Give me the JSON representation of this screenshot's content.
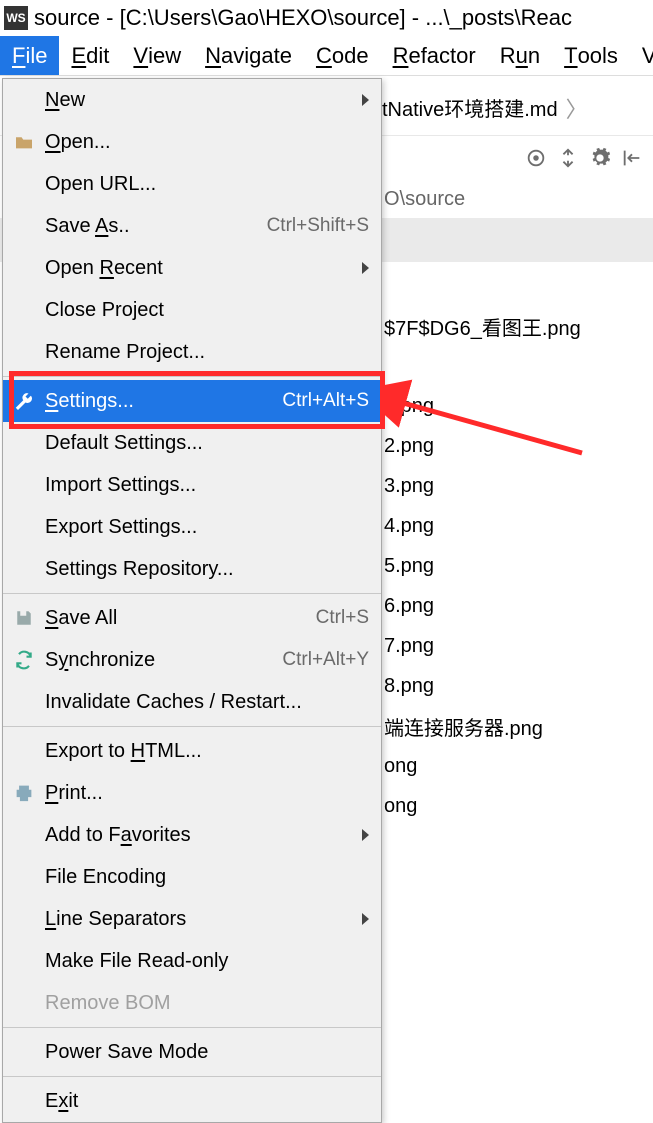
{
  "title": "source - [C:\\Users\\Gao\\HEXO\\source] - ...\\_posts\\Reac",
  "menu": [
    "File",
    "Edit",
    "View",
    "Navigate",
    "Code",
    "Refactor",
    "Run",
    "Tools",
    "V"
  ],
  "breadcrumb_tail": "tNative环境搭建.md",
  "path_tail": "O\\source",
  "file_menu": {
    "groups": [
      [
        {
          "label": "New",
          "shortcut": "",
          "submenu": true,
          "icon": ""
        },
        {
          "label": "Open...",
          "shortcut": "",
          "icon": "folder"
        },
        {
          "label": "Open URL...",
          "shortcut": "",
          "icon": ""
        },
        {
          "label": "Save As..",
          "shortcut": "Ctrl+Shift+S",
          "icon": ""
        },
        {
          "label": "Open Recent",
          "shortcut": "",
          "submenu": true,
          "icon": ""
        },
        {
          "label": "Close Project",
          "shortcut": "",
          "icon": ""
        },
        {
          "label": "Rename Project...",
          "shortcut": "",
          "icon": ""
        }
      ],
      [
        {
          "label": "Settings...",
          "shortcut": "Ctrl+Alt+S",
          "icon": "wrench",
          "highlight": true
        },
        {
          "label": "Default Settings...",
          "shortcut": "",
          "icon": ""
        },
        {
          "label": "Import Settings...",
          "shortcut": "",
          "icon": ""
        },
        {
          "label": "Export Settings...",
          "shortcut": "",
          "icon": ""
        },
        {
          "label": "Settings Repository...",
          "shortcut": "",
          "icon": ""
        }
      ],
      [
        {
          "label": "Save All",
          "shortcut": "Ctrl+S",
          "icon": "save"
        },
        {
          "label": "Synchronize",
          "shortcut": "Ctrl+Alt+Y",
          "icon": "sync"
        },
        {
          "label": "Invalidate Caches / Restart...",
          "shortcut": "",
          "icon": ""
        }
      ],
      [
        {
          "label": "Export to HTML...",
          "shortcut": "",
          "icon": ""
        },
        {
          "label": "Print...",
          "shortcut": "",
          "icon": "print"
        },
        {
          "label": "Add to Favorites",
          "shortcut": "",
          "submenu": true,
          "icon": ""
        },
        {
          "label": "File Encoding",
          "shortcut": "",
          "icon": ""
        },
        {
          "label": "Line Separators",
          "shortcut": "",
          "submenu": true,
          "icon": ""
        },
        {
          "label": "Make File Read-only",
          "shortcut": "",
          "icon": ""
        },
        {
          "label": "Remove BOM",
          "shortcut": "",
          "icon": "",
          "disabled": true
        }
      ],
      [
        {
          "label": "Power Save Mode",
          "shortcut": "",
          "icon": ""
        }
      ],
      [
        {
          "label": "Exit",
          "shortcut": "",
          "icon": ""
        }
      ]
    ]
  },
  "files": [
    "$7F$DG6_看图王.png",
    "1.png",
    "2.png",
    "3.png",
    "4.png",
    "5.png",
    "6.png",
    "7.png",
    "8.png",
    "端连接服务器.png",
    "ong",
    "ong"
  ]
}
